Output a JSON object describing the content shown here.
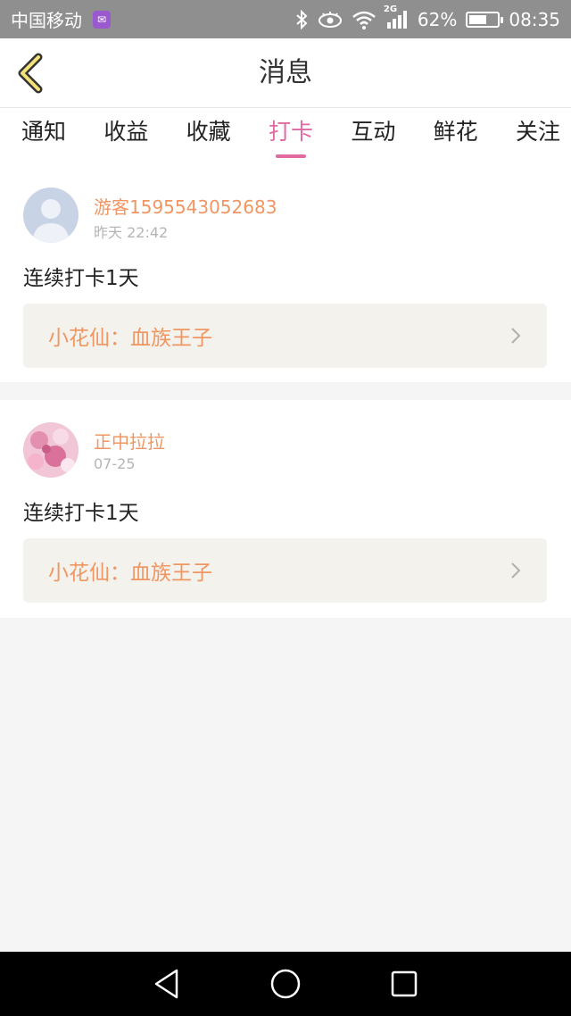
{
  "status_bar": {
    "carrier": "中国移动",
    "network": "2G",
    "battery": "62%",
    "battery_level": 0.62,
    "time": "08:35"
  },
  "header": {
    "title": "消息"
  },
  "tabs": [
    {
      "label": "通知",
      "active": false
    },
    {
      "label": "收益",
      "active": false
    },
    {
      "label": "收藏",
      "active": false
    },
    {
      "label": "打卡",
      "active": true
    },
    {
      "label": "互动",
      "active": false
    },
    {
      "label": "鲜花",
      "active": false
    },
    {
      "label": "关注",
      "active": false
    }
  ],
  "messages": [
    {
      "username": "游客1595543052683",
      "time": "昨天 22:42",
      "text": "连续打卡1天",
      "link": "小花仙：血族王子"
    },
    {
      "username": "正中拉拉",
      "time": "07-25",
      "text": "连续打卡1天",
      "link": "小花仙：血族王子"
    }
  ],
  "colors": {
    "accent": "#e16aa2",
    "username": "#f09663",
    "link_bg": "#f3f2ec"
  }
}
